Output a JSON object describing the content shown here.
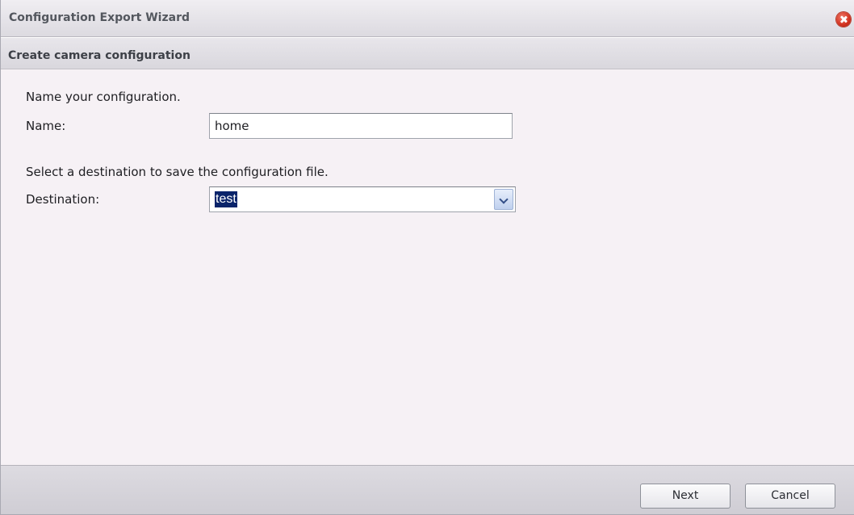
{
  "window": {
    "title": "Configuration Export Wizard",
    "close_icon": "close-icon"
  },
  "section": {
    "title": "Create camera configuration"
  },
  "form": {
    "name_instruction": "Name your configuration.",
    "name_label": "Name:",
    "name_value": "home",
    "destination_instruction": "Select a destination to save the configuration file.",
    "destination_label": "Destination:",
    "destination_value": "test",
    "dropdown_icon": "chevron-down-icon"
  },
  "footer": {
    "next_label": "Next",
    "cancel_label": "Cancel"
  },
  "colors": {
    "selection_highlight": "#0a246a",
    "close_button": "#d2321f",
    "panel_background": "#f6f1f5"
  }
}
